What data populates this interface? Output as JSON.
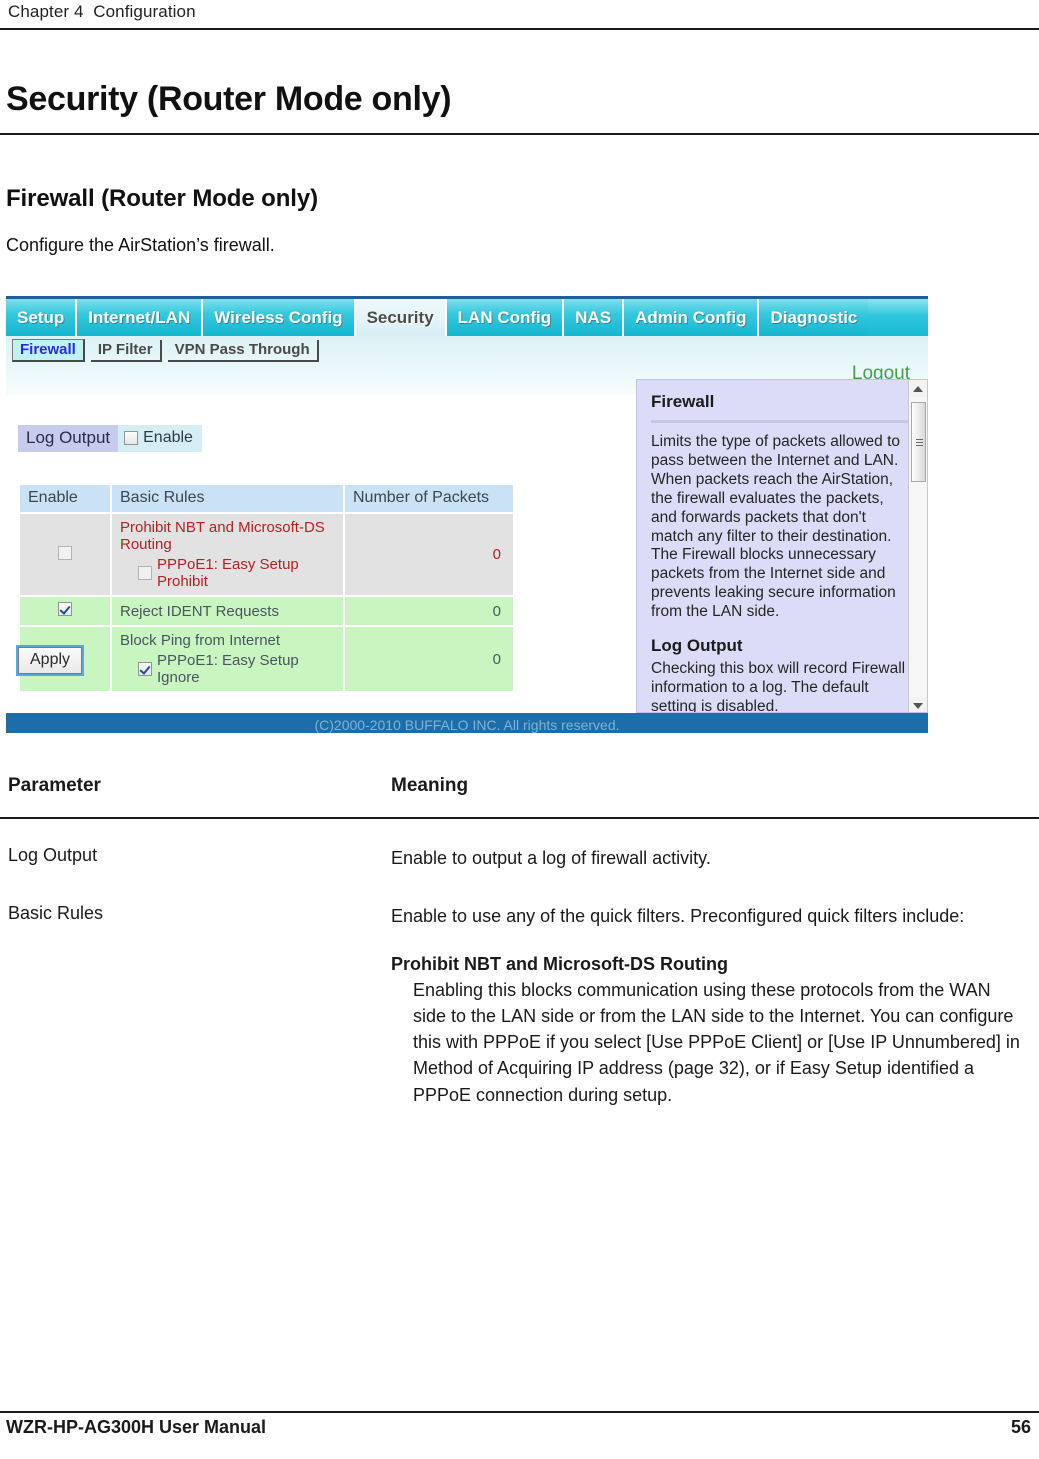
{
  "page": {
    "chapter": "Chapter 4  Configuration",
    "h1": "Security (Router Mode only)",
    "h2": "Firewall (Router Mode only)",
    "intro": "Configure the AirStation’s firewall.",
    "footer_left": "WZR-HP-AG300H User Manual",
    "footer_page": "56"
  },
  "screenshot": {
    "tabs": [
      {
        "label": "Setup",
        "active": false
      },
      {
        "label": "Internet/LAN",
        "active": false
      },
      {
        "label": "Wireless Config",
        "active": false
      },
      {
        "label": "Security",
        "active": true
      },
      {
        "label": "LAN Config",
        "active": false
      },
      {
        "label": "NAS",
        "active": false
      },
      {
        "label": "Admin Config",
        "active": false
      },
      {
        "label": "Diagnostic",
        "active": false
      }
    ],
    "subtabs": [
      {
        "label": "Firewall",
        "current": true
      },
      {
        "label": "IP Filter",
        "current": false
      },
      {
        "label": "VPN Pass Through",
        "current": false
      }
    ],
    "logout_label": "Logout",
    "log_output": {
      "label": "Log Output",
      "enable_label": "Enable",
      "checked": false
    },
    "table": {
      "headers": [
        "Enable",
        "Basic Rules",
        "Number of Packets"
      ],
      "rows": [
        {
          "enabled": false,
          "row_style": "grey",
          "title": "Prohibit NBT and Microsoft-DS Routing",
          "sub_label": "PPPoE1: Easy Setup Prohibit",
          "sub_checked": false,
          "packets": "0"
        },
        {
          "enabled": true,
          "row_style": "green",
          "title": "Reject IDENT Requests",
          "sub_label": "",
          "sub_checked": false,
          "packets": "0"
        },
        {
          "enabled": true,
          "row_style": "green",
          "title": "Block Ping from Internet",
          "sub_label": "PPPoE1: Easy Setup Ignore",
          "sub_checked": true,
          "packets": "0"
        }
      ]
    },
    "apply_label": "Apply",
    "help": {
      "title": "Firewall",
      "body": "Limits the type of packets allowed to pass between the Internet and LAN. When packets reach the AirStation, the firewall evaluates the packets, and forwards packets that don't match any filter to their destination. The Firewall blocks unnecessary packets from the Internet side and prevents leaking secure information from the LAN side.",
      "sub_title": "Log Output",
      "sub_body": "Checking this box will record Firewall information to a log.\nThe default setting is disabled."
    },
    "copyright": "(C)2000-2010 BUFFALO INC. All rights reserved."
  },
  "param_table": {
    "headers": {
      "parameter": "Parameter",
      "meaning": "Meaning"
    },
    "rows": [
      {
        "parameter": "Log Output",
        "meaning": "Enable to output a log of firewall activity.",
        "sub_heading": "",
        "sub_text": ""
      },
      {
        "parameter": "Basic Rules",
        "meaning": "Enable to use any of the quick filters. Preconfigured quick filters include:",
        "sub_heading": "Prohibit NBT and Microsoft-DS Routing",
        "sub_text": "Enabling this blocks communication using these protocols from the WAN side to the LAN side or from the LAN side to the Internet. You can configure this with PPPoE if you select [Use PPPoE Client] or [Use IP Unnumbered] in Method of Acquiring IP address (page 32), or if Easy Setup identified a PPPoE connection during setup."
      }
    ]
  },
  "colors": {
    "tab_cyan": "#18b9d2",
    "footer_blue": "#1d6ea8",
    "help_lilac": "#dcdcf8",
    "row_green": "#c9f6c0",
    "row_grey": "#e2e2e2",
    "header_blue": "#c9e2f5",
    "logout_green": "#3ea346",
    "rule_red": "#b42121"
  }
}
